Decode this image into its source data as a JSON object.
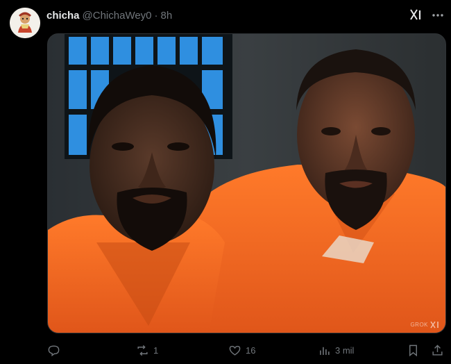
{
  "post": {
    "display_name": "chicha",
    "handle": "@ChichaWey0",
    "separator": "·",
    "time": "8h"
  },
  "media": {
    "watermark": "GROK"
  },
  "actions": {
    "replies": {
      "icon": "reply-icon",
      "count": ""
    },
    "reposts": {
      "icon": "repost-icon",
      "count": "1"
    },
    "likes": {
      "icon": "heart-icon",
      "count": "16"
    },
    "views": {
      "icon": "views-icon",
      "count": "3 mil"
    },
    "bookmark": {
      "icon": "bookmark-icon"
    },
    "share": {
      "icon": "share-icon"
    }
  },
  "colors": {
    "background": "#000000",
    "text": "#e7e9ea",
    "muted": "#71767b",
    "jumpsuit": "#f06a1c"
  }
}
